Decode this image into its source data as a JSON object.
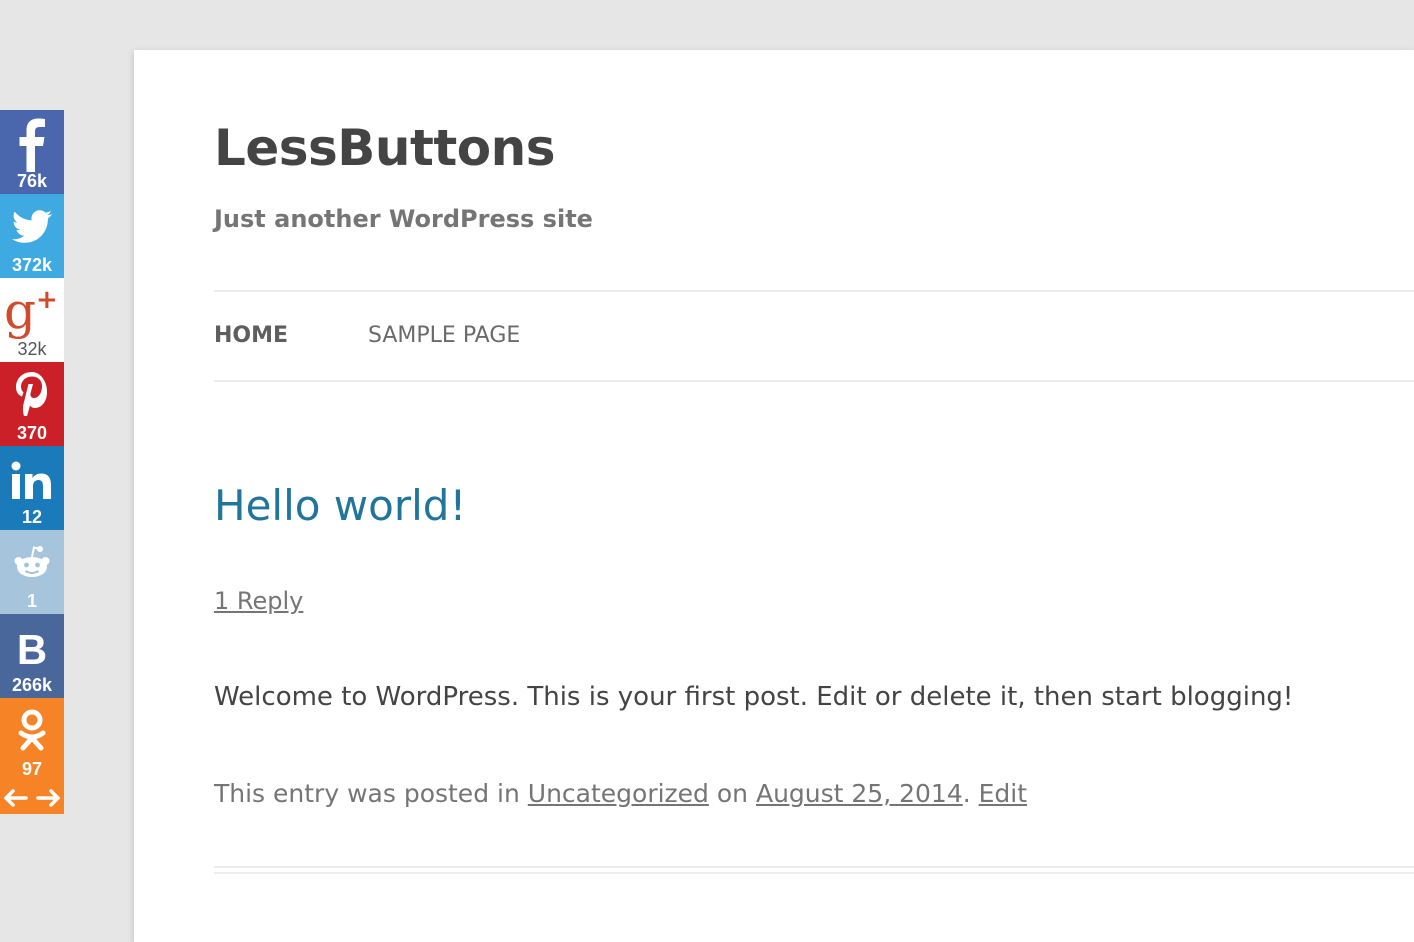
{
  "site": {
    "title": "LessButtons",
    "description": "Just another WordPress site"
  },
  "nav": {
    "items": [
      {
        "label": "HOME"
      },
      {
        "label": "SAMPLE PAGE"
      }
    ]
  },
  "post": {
    "title": "Hello world!",
    "reply_link": "1 Reply",
    "content": "Welcome to WordPress. This is your first post. Edit or delete it, then start blogging!",
    "meta": {
      "prefix": "This entry was posted in",
      "category": "Uncategorized",
      "on_word": "on",
      "date": "August 25, 2014",
      "separator": ".",
      "edit": "Edit"
    }
  },
  "share_bar": {
    "buttons": [
      {
        "network": "facebook",
        "icon": "facebook-icon",
        "count": "76k",
        "color": "#4a67ad"
      },
      {
        "network": "twitter",
        "icon": "twitter-icon",
        "count": "372k",
        "color": "#3fa9e2"
      },
      {
        "network": "google-plus",
        "icon": "google-plus-icon",
        "count": "32k",
        "color": "#ffffff"
      },
      {
        "network": "pinterest",
        "icon": "pinterest-icon",
        "count": "370",
        "color": "#cb2027"
      },
      {
        "network": "linkedin",
        "icon": "linkedin-icon",
        "count": "12",
        "color": "#1b7ab9"
      },
      {
        "network": "reddit",
        "icon": "reddit-icon",
        "count": "1",
        "color": "#a6c4dc"
      },
      {
        "network": "vkontakte",
        "icon": "vkontakte-icon",
        "count": "266k",
        "color": "#49679a"
      },
      {
        "network": "odnoklassniki",
        "icon": "odnoklassniki-icon",
        "count": "97",
        "color": "#f68426"
      }
    ],
    "toggle_icon": "left-right-arrows-icon"
  },
  "colors": {
    "link_blue": "#21759b",
    "text_dark": "#444444",
    "text_muted": "#757575",
    "background": "#e6e6e6"
  }
}
